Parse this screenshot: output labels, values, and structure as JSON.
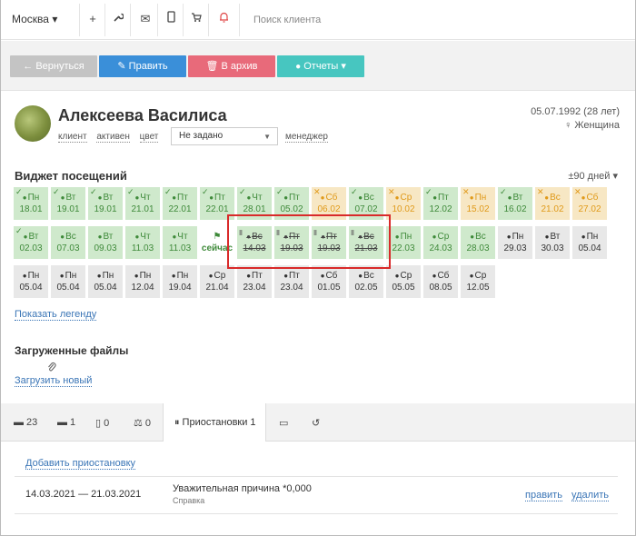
{
  "topbar": {
    "city": "Москва",
    "city_caret": "▾",
    "search_placeholder": "Поиск клиента",
    "icons": {
      "add": "+",
      "wrench": "🔧",
      "mail": "✉",
      "phone": "▯",
      "cart": "🛒",
      "bell": "🔔"
    }
  },
  "actions": {
    "back": "← Вернуться",
    "edit": "✎ Править",
    "archive": "🗑 В архив",
    "reports": "Отчеты ▾",
    "colors": {
      "back": "#c4c4c4",
      "edit": "#3a8fd9",
      "archive": "#e86a7a",
      "reports": "#47c6c0"
    }
  },
  "client": {
    "name": "Алексеева Василиса",
    "tag_client": "клиент",
    "tag_active": "активен",
    "tag_color": "цвет",
    "status_select": "Не задано",
    "manager": "менеджер",
    "dob": "05.07.1992 (28 лет)",
    "gender": "♀ Женщина"
  },
  "visits_widget": {
    "title": "Виджет посещений",
    "period": "±90 дней ▾",
    "cells": [
      {
        "day": "Пн",
        "date": "18.01",
        "style": "green",
        "mark": "ok"
      },
      {
        "day": "Вт",
        "date": "19.01",
        "style": "green",
        "mark": "ok"
      },
      {
        "day": "Вт",
        "date": "19.01",
        "style": "green",
        "mark": "ok"
      },
      {
        "day": "Чт",
        "date": "21.01",
        "style": "green",
        "mark": "ok"
      },
      {
        "day": "Пт",
        "date": "22.01",
        "style": "green",
        "mark": "ok"
      },
      {
        "day": "Пт",
        "date": "22.01",
        "style": "green",
        "mark": "ok"
      },
      {
        "day": "Чт",
        "date": "28.01",
        "style": "green",
        "mark": "ok"
      },
      {
        "day": "Пт",
        "date": "05.02",
        "style": "green",
        "mark": "ok"
      },
      {
        "day": "Сб",
        "date": "06.02",
        "style": "orange",
        "mark": "x"
      },
      {
        "day": "Вс",
        "date": "07.02",
        "style": "green",
        "mark": "ok"
      },
      {
        "day": "Ср",
        "date": "10.02",
        "style": "orange",
        "mark": "x"
      },
      {
        "day": "Пт",
        "date": "12.02",
        "style": "green",
        "mark": "ok"
      },
      {
        "day": "Пн",
        "date": "15.02",
        "style": "orange",
        "mark": "x"
      },
      {
        "day": "Вт",
        "date": "16.02",
        "style": "green",
        "mark": "ok"
      },
      {
        "day": "Вс",
        "date": "21.02",
        "style": "orange",
        "mark": "x"
      },
      {
        "day": "Сб",
        "date": "27.02",
        "style": "orange",
        "mark": "x"
      },
      {
        "day": "Вт",
        "date": "02.03",
        "style": "green",
        "mark": "ok"
      },
      {
        "day": "Вс",
        "date": "07.03",
        "style": "green",
        "mark": ""
      },
      {
        "day": "Вт",
        "date": "09.03",
        "style": "green",
        "mark": ""
      },
      {
        "day": "Чт",
        "date": "11.03",
        "style": "green",
        "mark": ""
      },
      {
        "day": "Чт",
        "date": "11.03",
        "style": "green",
        "mark": ""
      },
      {
        "day": "⚑",
        "date": "сейчас",
        "style": "white",
        "mark": ""
      },
      {
        "day": "Вс",
        "date": "14.03",
        "style": "strike",
        "mark": "pause"
      },
      {
        "day": "Пт",
        "date": "19.03",
        "style": "strike",
        "mark": "pause"
      },
      {
        "day": "Пт",
        "date": "19.03",
        "style": "strike",
        "mark": "pause"
      },
      {
        "day": "Вс",
        "date": "21.03",
        "style": "strike",
        "mark": "pause"
      },
      {
        "day": "Пн",
        "date": "22.03",
        "style": "green",
        "mark": ""
      },
      {
        "day": "Ср",
        "date": "24.03",
        "style": "green",
        "mark": ""
      },
      {
        "day": "Вс",
        "date": "28.03",
        "style": "green",
        "mark": ""
      },
      {
        "day": "Пн",
        "date": "29.03",
        "style": "gray",
        "mark": ""
      },
      {
        "day": "Вт",
        "date": "30.03",
        "style": "gray",
        "mark": ""
      },
      {
        "day": "Пн",
        "date": "05.04",
        "style": "gray",
        "mark": ""
      },
      {
        "day": "Пн",
        "date": "05.04",
        "style": "gray",
        "mark": ""
      },
      {
        "day": "Пн",
        "date": "05.04",
        "style": "gray",
        "mark": ""
      },
      {
        "day": "Пн",
        "date": "05.04",
        "style": "gray",
        "mark": ""
      },
      {
        "day": "Пн",
        "date": "12.04",
        "style": "gray",
        "mark": ""
      },
      {
        "day": "Пн",
        "date": "19.04",
        "style": "gray",
        "mark": ""
      },
      {
        "day": "Ср",
        "date": "21.04",
        "style": "gray",
        "mark": ""
      },
      {
        "day": "Пт",
        "date": "23.04",
        "style": "gray",
        "mark": ""
      },
      {
        "day": "Пт",
        "date": "23.04",
        "style": "gray",
        "mark": ""
      },
      {
        "day": "Сб",
        "date": "01.05",
        "style": "gray",
        "mark": ""
      },
      {
        "day": "Вс",
        "date": "02.05",
        "style": "gray",
        "mark": ""
      },
      {
        "day": "Ср",
        "date": "05.05",
        "style": "gray",
        "mark": ""
      },
      {
        "day": "Сб",
        "date": "08.05",
        "style": "gray",
        "mark": ""
      },
      {
        "day": "Ср",
        "date": "12.05",
        "style": "gray",
        "mark": ""
      }
    ],
    "show_legend": "Показать легенду"
  },
  "files": {
    "title": "Загруженные файлы",
    "upload": "Загрузить новый"
  },
  "tabs": {
    "t1": "▬ 23",
    "t2": "▬ 1",
    "t3": "▯ 0",
    "t4": "⚖ 0",
    "active": "⏸ Приостановки 1",
    "t6": "▭",
    "t7": "↺"
  },
  "pauses": {
    "add": "Добавить приостановку",
    "rows": [
      {
        "dates": "14.03.2021 — 21.03.2021",
        "reason": "Уважительная причина *0,000",
        "sub": "Справка",
        "edit": "править",
        "delete": "удалить"
      }
    ]
  }
}
